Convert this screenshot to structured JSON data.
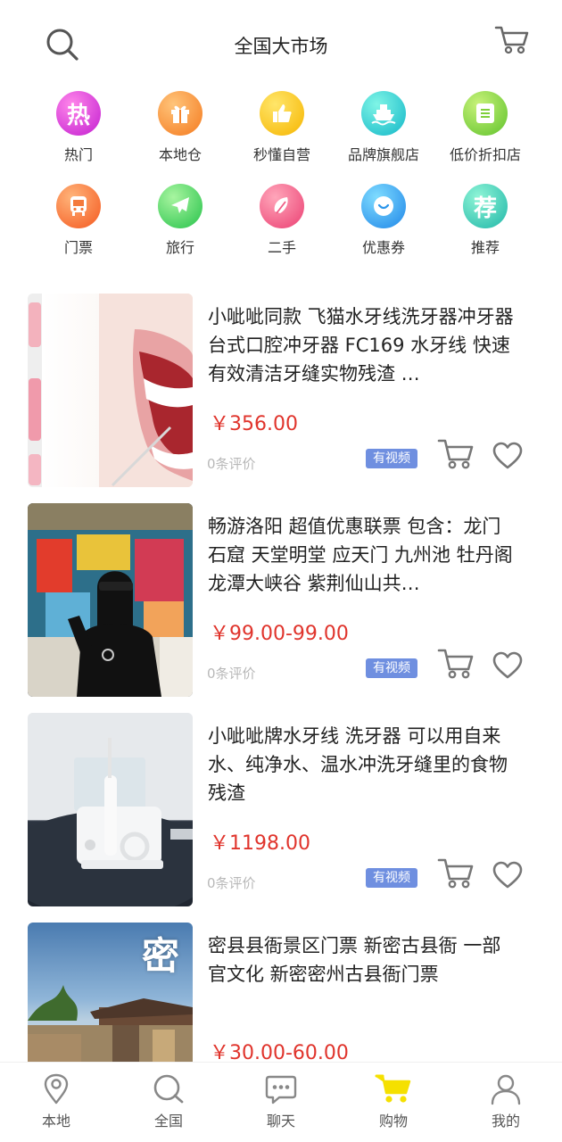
{
  "header": {
    "title": "全国大市场"
  },
  "categories": [
    {
      "label": "热门",
      "glyph": "热",
      "icon": "hot-icon",
      "colors": [
        "#f75fdc",
        "#c21ed0"
      ]
    },
    {
      "label": "本地仓",
      "glyph": "",
      "icon": "gift-icon",
      "colors": [
        "#ffb45a",
        "#f47a1f"
      ]
    },
    {
      "label": "秒懂自营",
      "glyph": "",
      "icon": "thumbs-up-icon",
      "colors": [
        "#ffe04a",
        "#f6b500"
      ]
    },
    {
      "label": "品牌旗舰店",
      "glyph": "",
      "icon": "ship-icon",
      "colors": [
        "#5ff0e0",
        "#13b7c8"
      ]
    },
    {
      "label": "低价折扣店",
      "glyph": "",
      "icon": "store-icon",
      "colors": [
        "#b6ec5a",
        "#5fc22b"
      ]
    },
    {
      "label": "门票",
      "glyph": "",
      "icon": "ticket-icon",
      "colors": [
        "#ffa562",
        "#f4581f"
      ]
    },
    {
      "label": "旅行",
      "glyph": "",
      "icon": "plane-icon",
      "colors": [
        "#8ff08a",
        "#26c24a"
      ]
    },
    {
      "label": "二手",
      "glyph": "",
      "icon": "second-hand-icon",
      "colors": [
        "#ff8fa8",
        "#eb3f72"
      ]
    },
    {
      "label": "优惠券",
      "glyph": "",
      "icon": "coupon-icon",
      "colors": [
        "#5fd0ff",
        "#1f86e8"
      ]
    },
    {
      "label": "推荐",
      "glyph": "荐",
      "icon": "recommend-icon",
      "colors": [
        "#6ff0c8",
        "#1fb6a8"
      ]
    }
  ],
  "products": [
    {
      "title": "小呲呲同款 飞猫水牙线洗牙器冲牙器 台式口腔冲牙器 FC169 水牙线 快速有效清洁牙缝实物残渣 …",
      "price": "￥356.00",
      "reviews": "0条评价",
      "badge": "有视频",
      "image": "smile-teeth-photo"
    },
    {
      "title": "畅游洛阳 超值优惠联票 包含：龙门石窟 天堂明堂 应天门 九州池 牡丹阁 龙潭大峡谷 紫荆仙山共…",
      "price": "￥99.00-99.00",
      "reviews": "0条评价",
      "badge": "有视频",
      "image": "vr-girl-photo"
    },
    {
      "title": "小呲呲牌水牙线 洗牙器 可以用自来水、纯净水、温水冲洗牙缝里的食物残渣",
      "price": "￥1198.00",
      "reviews": "0条评价",
      "badge": "有视频",
      "image": "water-flosser-photo"
    },
    {
      "title": "密县县衙景区门票 新密古县衙 一部官文化 新密密州古县衙门票",
      "price": "￥30.00-60.00",
      "reviews": "",
      "badge": "",
      "image": "ancient-yamen-photo",
      "image_caption": "密"
    }
  ],
  "tabbar": [
    {
      "label": "本地",
      "icon": "location-pin-icon"
    },
    {
      "label": "全国",
      "icon": "search-icon"
    },
    {
      "label": "聊天",
      "icon": "chat-bubble-icon"
    },
    {
      "label": "购物",
      "icon": "shopping-cart-icon",
      "active": true,
      "active_color": "#f5e000"
    },
    {
      "label": "我的",
      "icon": "user-icon"
    }
  ],
  "colors": {
    "price": "#e0342c",
    "badge": "#6f8fe0",
    "icon_gray": "#777777"
  }
}
